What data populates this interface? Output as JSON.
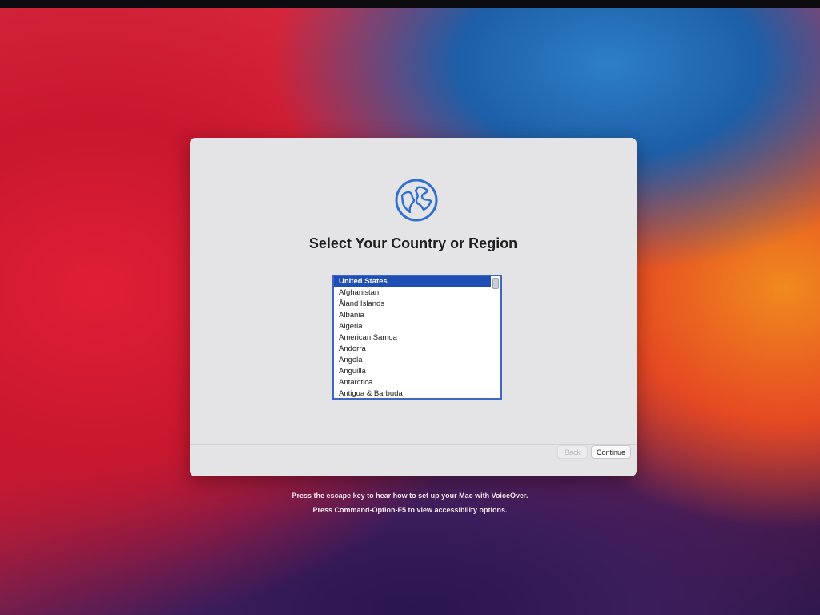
{
  "title": "Select Your Country or Region",
  "countries": [
    "United States",
    "Afghanistan",
    "Åland Islands",
    "Albania",
    "Algeria",
    "American Samoa",
    "Andorra",
    "Angola",
    "Anguilla",
    "Antarctica",
    "Antigua & Barbuda"
  ],
  "selected_country": "United States",
  "buttons": {
    "back": "Back",
    "continue": "Continue"
  },
  "hints": {
    "voiceover": "Press the escape key to hear how to set up your Mac with VoiceOver.",
    "accessibility": "Press Command-Option-F5 to view accessibility options."
  },
  "icons": {
    "globe": "globe-icon"
  },
  "colors": {
    "accent": "#1f4fb5",
    "globe": "#2f6fd0"
  }
}
